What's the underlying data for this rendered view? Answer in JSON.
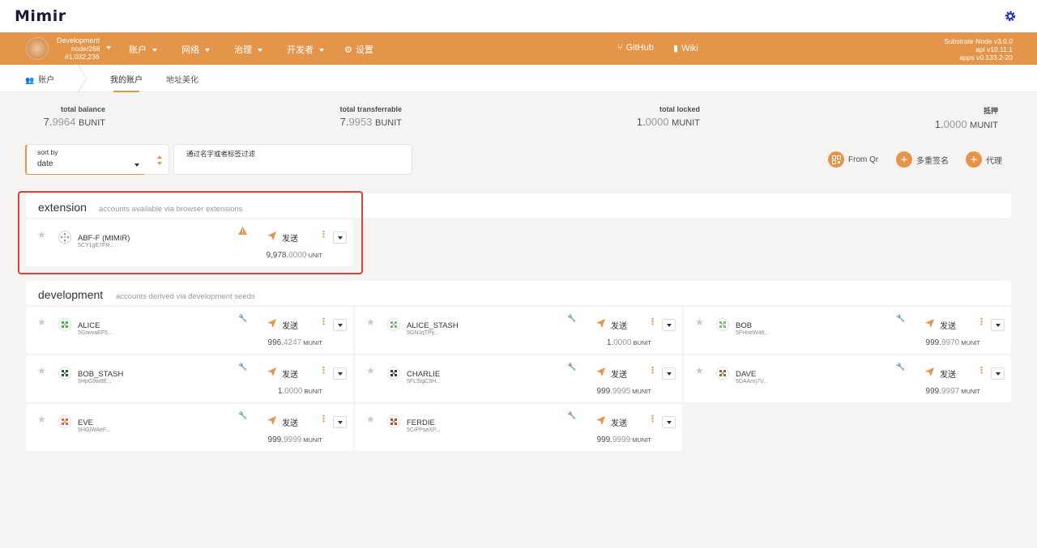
{
  "app": {
    "logo_text": "Mimir"
  },
  "nav": {
    "chain": {
      "name": "Development",
      "node": "node/268",
      "block": "#1,032,236"
    },
    "items": [
      {
        "label": "账户"
      },
      {
        "label": "网络"
      },
      {
        "label": "治理"
      },
      {
        "label": "开发者"
      },
      {
        "label": "设置"
      }
    ],
    "links": [
      {
        "label": "GitHub"
      },
      {
        "label": "Wiki"
      }
    ],
    "version": {
      "node": "Substrate Node v3.0.0",
      "api": "api v10.11.1",
      "apps": "apps v0.133.2-20"
    }
  },
  "tabs": {
    "section": "账户",
    "mine": "我的账户",
    "beautify": "地址美化"
  },
  "summary": [
    {
      "label": "total balance",
      "int": "7.",
      "dec": "9964",
      "unit": "BUNIT"
    },
    {
      "label": "total transferrable",
      "int": "7.",
      "dec": "9953",
      "unit": "BUNIT"
    },
    {
      "label": "total locked",
      "int": "1.",
      "dec": "0000",
      "unit": "MUNIT"
    },
    {
      "label": "抵押",
      "int": "1.",
      "dec": "0000",
      "unit": "MUNIT"
    }
  ],
  "controls": {
    "sort_label": "sort by",
    "sort_value": "date",
    "filter_label": "通过名字或者标签过滤",
    "from_qr": "From Qr",
    "multisig": "多重签名",
    "proxy": "代理"
  },
  "groups": {
    "extension": {
      "title": "extension",
      "desc": "accounts available via browser extensions"
    },
    "development": {
      "title": "development",
      "desc": "accounts derived via development seeds"
    }
  },
  "send_label": "发送",
  "accounts": {
    "extension": [
      {
        "name": "ABF-F (MIMIR)",
        "address": "5CY1gE7FR...",
        "int": "9,978.",
        "dec": "0000",
        "unit": "UNIT"
      }
    ],
    "development": [
      {
        "name": "ALICE",
        "address": "5GrwvaEF5...",
        "int": "996.",
        "dec": "4247",
        "unit": "MUNIT",
        "color": "#4caf50"
      },
      {
        "name": "ALICE_STASH",
        "address": "5GNJqTPy...",
        "int": "1.",
        "dec": "0000",
        "unit": "BUNIT",
        "color": "#7fb07a"
      },
      {
        "name": "BOB",
        "address": "5FHneW46...",
        "int": "999.",
        "dec": "9970",
        "unit": "MUNIT",
        "color": "#7fbf6a"
      },
      {
        "name": "BOB_STASH",
        "address": "5HpG9w8E...",
        "int": "1.",
        "dec": "0000",
        "unit": "BUNIT",
        "color": "#2e5d2e"
      },
      {
        "name": "CHARLIE",
        "address": "5FLSigC9H...",
        "int": "999.",
        "dec": "9995",
        "unit": "MUNIT",
        "color": "#3a3a3a"
      },
      {
        "name": "DAVE",
        "address": "5DAAnrj7V...",
        "int": "999.",
        "dec": "9997",
        "unit": "MUNIT",
        "color": "#8a6a3a"
      },
      {
        "name": "EVE",
        "address": "5HGjWAeF...",
        "int": "999.",
        "dec": "9999",
        "unit": "MUNIT",
        "color": "#d9684f"
      },
      {
        "name": "FERDIE",
        "address": "5CiPPseXP...",
        "int": "999.",
        "dec": "9999",
        "unit": "MUNIT",
        "color": "#a0522d"
      }
    ]
  },
  "colors": {
    "accent": "#e5954a",
    "highlight": "#d9432f"
  }
}
